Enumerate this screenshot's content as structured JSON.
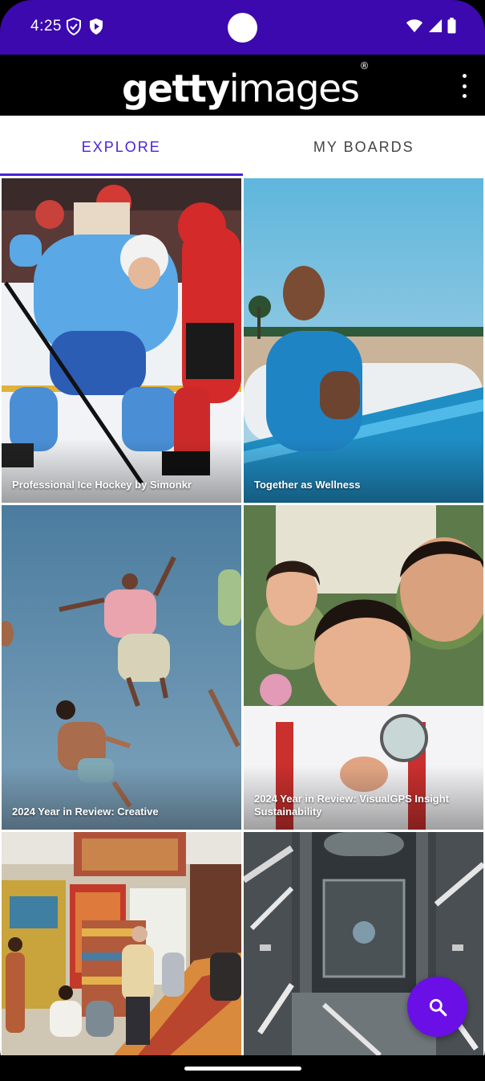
{
  "status_bar": {
    "time": "4:25",
    "left_icons": [
      "shield-icon",
      "play-protect-icon"
    ],
    "right_icons": [
      "wifi-icon",
      "signal-icon",
      "battery-icon"
    ]
  },
  "app_bar": {
    "logo_bold": "getty",
    "logo_light": "images",
    "logo_mark": "®",
    "menu_icon": "more-vert-icon"
  },
  "tabs": [
    {
      "label": "EXPLORE",
      "active": true
    },
    {
      "label": "MY BOARDS",
      "active": false
    }
  ],
  "boards": [
    {
      "caption": "Professional Ice Hockey by Simonkr"
    },
    {
      "caption": "Together as Wellness"
    },
    {
      "caption": "2024 Year in Review: Creative"
    },
    {
      "caption": "2024 Year in Review: VisualGPS Insight Sustainability"
    },
    {
      "caption": ""
    },
    {
      "caption": ""
    }
  ],
  "fab": {
    "icon": "search-icon"
  },
  "colors": {
    "status_bar": "#3b09ad",
    "accent": "#4b22d6",
    "fab": "#6a0fe6"
  }
}
